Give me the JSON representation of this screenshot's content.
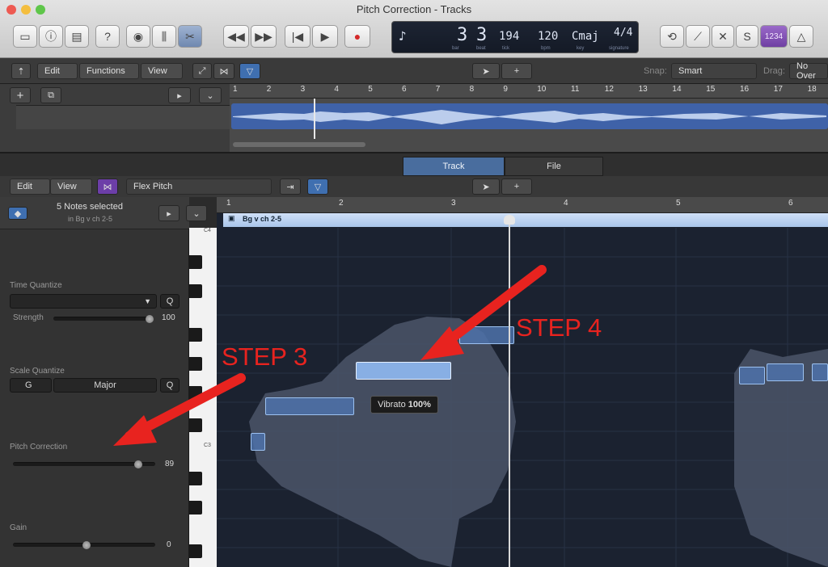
{
  "window": {
    "title": "Pitch Correction - Tracks"
  },
  "lcd": {
    "bar": "3",
    "beat": "3",
    "tick": "194",
    "bpm": "120",
    "key": "Cmaj",
    "signature": "4/4",
    "caption_bar": "bar",
    "caption_beat": "beat",
    "caption_tick": "tick",
    "caption_bpm": "bpm",
    "caption_key": "key",
    "caption_signature": "signature"
  },
  "toolbar": {
    "count_in": "1234"
  },
  "tracks_bar": {
    "edit": "Edit",
    "functions": "Functions",
    "view": "View",
    "snap_label": "Snap:",
    "snap_value": "Smart",
    "drag_label": "Drag:",
    "drag_value": "No Over"
  },
  "ruler_top": [
    "1",
    "2",
    "3",
    "4",
    "5",
    "6",
    "7",
    "8",
    "9",
    "10",
    "11",
    "12",
    "13",
    "14",
    "15",
    "16",
    "17",
    "18"
  ],
  "tabs": {
    "track": "Track",
    "file": "File"
  },
  "editor_bar": {
    "edit": "Edit",
    "view": "View",
    "mode": "Flex Pitch"
  },
  "inspector": {
    "selected": "5 Notes selected",
    "region": "in Bg v ch 2-5",
    "time_quantize_label": "Time Quantize",
    "q_label": "Q",
    "strength_label": "Strength",
    "strength_value": "100",
    "scale_quantize_label": "Scale Quantize",
    "scale_root": "G",
    "scale_type": "Major",
    "pitch_correction_label": "Pitch Correction",
    "pitch_correction_value": "89",
    "gain_label": "Gain",
    "gain_value": "0"
  },
  "keys": {
    "c4": "C4",
    "c3": "C3"
  },
  "editor_ruler": [
    "1",
    "2",
    "3",
    "4",
    "5",
    "6"
  ],
  "region_name": "Bg v ch 2-5",
  "tooltip": {
    "label": "Vibrato",
    "value": "100%"
  },
  "annotations": {
    "step3": "STEP 3",
    "step4": "STEP 4"
  }
}
